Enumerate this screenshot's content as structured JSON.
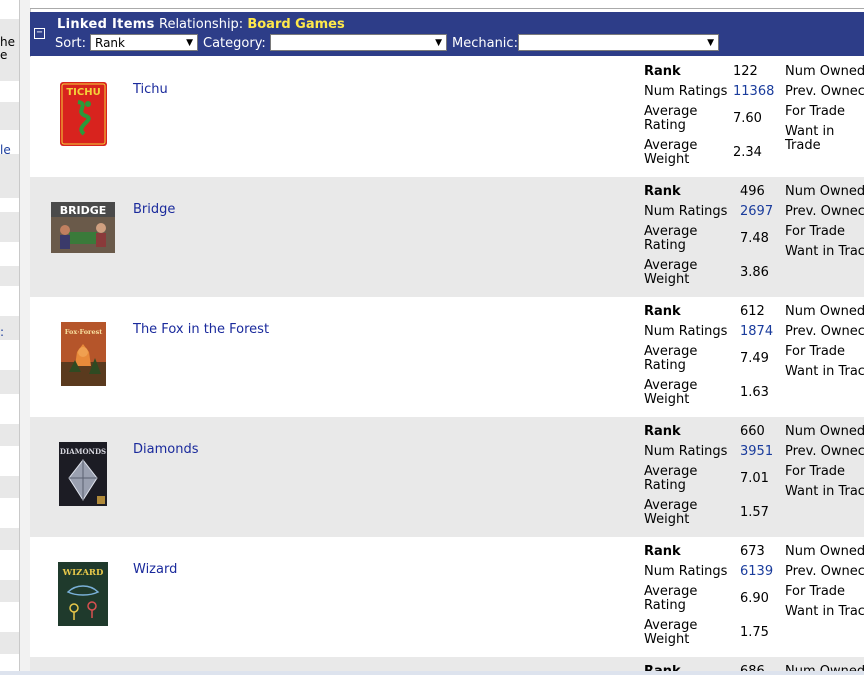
{
  "left_strip": {
    "texts": [
      {
        "text": "he",
        "link": false
      },
      {
        "text": "e",
        "link": false
      },
      {
        "text": "le",
        "link": true
      },
      {
        "text": ":",
        "link": true
      }
    ]
  },
  "header": {
    "title": "Linked Items",
    "relationship_label": "Relationship:",
    "relationship_value": "Board Games",
    "sort_label": "Sort:",
    "sort_value": "Rank",
    "category_label": "Category:",
    "category_value": "",
    "mechanic_label": "Mechanic:",
    "mechanic_value": "",
    "toggle_glyph": "−",
    "dropdown_glyph": "▼"
  },
  "stat_labels": {
    "rank": "Rank",
    "num_ratings": "Num Ratings",
    "avg_rating_1": "Average",
    "avg_rating_2": "Rating",
    "avg_weight_1": "Average",
    "avg_weight_2": "Weight",
    "num_owned": "Num Owned",
    "prev_owned": "Prev. Ownec",
    "for_trade": "For Trade",
    "want_in_trade": "Want in Trac",
    "want_in_1": "Want in",
    "want_in_2": "Trade"
  },
  "games": [
    {
      "name": "Tichu",
      "rank": "122",
      "num_ratings": "11368",
      "avg_rating": "7.60",
      "avg_weight": "2.34"
    },
    {
      "name": "Bridge",
      "rank": "496",
      "num_ratings": "2697",
      "avg_rating": "7.48",
      "avg_weight": "3.86"
    },
    {
      "name": "The Fox in the Forest",
      "rank": "612",
      "num_ratings": "1874",
      "avg_rating": "7.49",
      "avg_weight": "1.63"
    },
    {
      "name": "Diamonds",
      "rank": "660",
      "num_ratings": "3951",
      "avg_rating": "7.01",
      "avg_weight": "1.57"
    },
    {
      "name": "Wizard",
      "rank": "673",
      "num_ratings": "6139",
      "avg_rating": "6.90",
      "avg_weight": "1.75"
    }
  ],
  "partial_row": {
    "rank_label": "Rank",
    "rank": "686",
    "num_owned": "Num Owned"
  },
  "thumb_text": {
    "tichu": "TICHU",
    "bridge": "BRIDGE",
    "fox": "Fox·Forest",
    "diamonds": "DIAMONDS",
    "wizard": "WIZARD"
  },
  "colors": {
    "header_bg": "#2d3d88",
    "relationship_value": "#ffe94a",
    "link": "#1a2a9c",
    "row_alt": "#e9e9e9"
  }
}
